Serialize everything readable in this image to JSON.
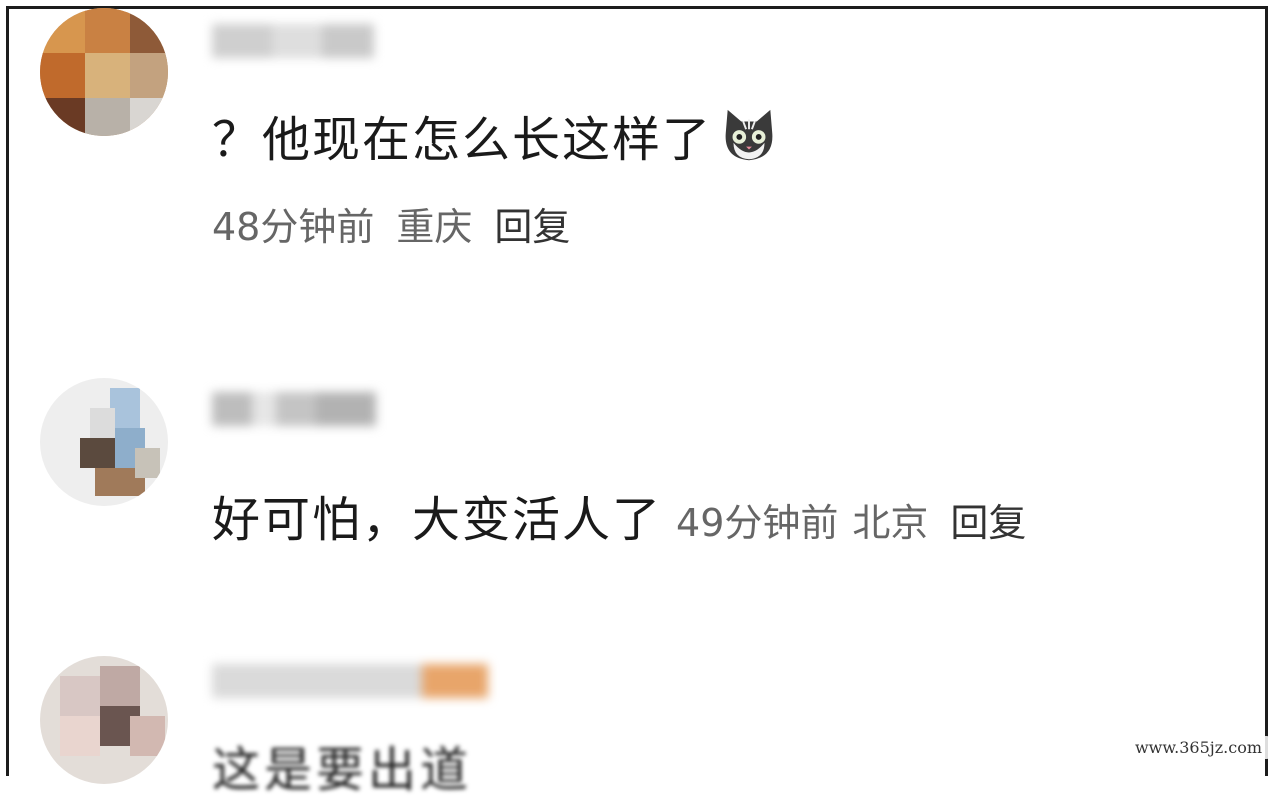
{
  "comments": [
    {
      "text": "？他现在怎么长这样了",
      "emoji": "cat-emoji",
      "time": "48分钟前",
      "location": "重庆",
      "reply_label": "回复"
    },
    {
      "text": "好可怕，大变活人了",
      "time": "49分钟前",
      "location": "北京",
      "reply_label": "回复"
    },
    {
      "text_partial": "这是要出道"
    }
  ],
  "watermark": "www.365jz.com",
  "colors": {
    "text": "#1a1a1a",
    "meta": "#666666",
    "frame": "#1c1c1c"
  }
}
